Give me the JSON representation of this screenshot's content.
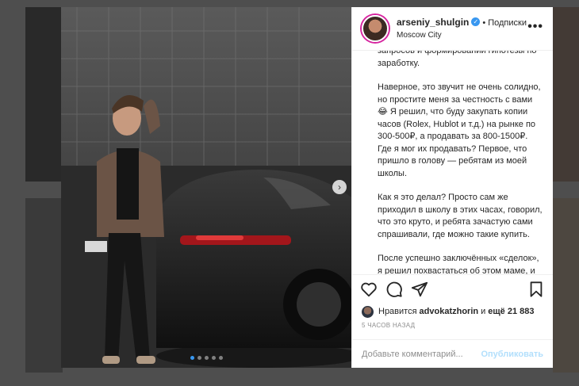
{
  "post": {
    "username": "arseniy_shulgin",
    "separator": "•",
    "follow_label": "Подписки",
    "location": "Moscow City",
    "more_label": "•••",
    "caption_paragraphs": [
      "запросов и формировании гипотезы по заработку.",
      "Наверное, это звучит не очень солидно, но простите меня за честность с вами 😂 Я решил, что буду закупать копии часов (Rolex, Hublot и т.д.) на рынке по 300-500₽, а продавать за 800-1500₽. Где я мог их продавать? Первое, что пришло в голову — ребятам из моей школы.",
      "Как я это делал? Просто сам же приходил в школу в этих часах, говорил, что это круто, и ребята зачастую сами спрашивали, где можно такие купить.",
      "После успешно заключённых «сделок», я решил похвастаться об этом маме, и сказал, что неплохо заработал деньжат, на что она"
    ],
    "likes_prefix": "Нравится",
    "likes_user": "advokatzhorin",
    "likes_conj": "и",
    "likes_count": "ещё 21 883",
    "time_ago": "5 ЧАСОВ НАЗАД",
    "comment_placeholder": "Добавьте комментарий...",
    "publish_label": "Опубликовать",
    "carousel_total": 5,
    "carousel_active": 1
  },
  "icons": {
    "like": "heart-icon",
    "comment": "comment-icon",
    "share": "share-icon",
    "save": "bookmark-icon",
    "verified": "verified-badge-icon",
    "next": "chevron-right-icon"
  },
  "colors": {
    "accent_blue": "#3897f0",
    "publish_disabled": "#b2dffc",
    "text": "#262626",
    "muted": "#8e8e8e"
  }
}
